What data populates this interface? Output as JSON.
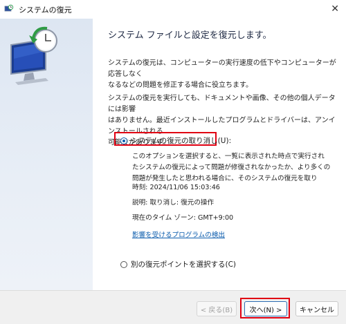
{
  "window": {
    "title": "システムの復元",
    "close_label": "✕"
  },
  "content": {
    "heading": "システム ファイルと設定を復元します。",
    "para1_line1": "システムの復元は、コンピューターの実行速度の低下やコンピューターが応答しなく",
    "para1_line2": "なるなどの問題を修正する場合に役立ちます。",
    "para2_line1": "システムの復元を実行しても、ドキュメントや画像、その他の個人データには影響",
    "para2_line2": "はありません。最近インストールしたプログラムとドライバーは、アンインストールされる",
    "para2_line3": "可能性があります。"
  },
  "option_undo": {
    "label": "システムの復元の取り消し(U):",
    "checked": true,
    "desc_line1": "このオプションを選択すると、一覧に表示された時点で実行され",
    "desc_line2": "たシステムの復元によって問題が修復されなかったか、より多くの",
    "desc_line3": "問題が発生したと思われる場合に、そのシステムの復元を取り",
    "time": "時刻: 2024/11/06 15:03:46",
    "description": "説明: 取り消し: 復元の操作",
    "timezone": "現在のタイム ゾーン: GMT+9:00",
    "link": "影響を受けるプログラムの検出"
  },
  "option_other": {
    "label": "別の復元ポイントを選択する(C)",
    "checked": false
  },
  "footer": {
    "back_label": "< 戻る(B)",
    "next_label": "次へ(N) >",
    "cancel_label": "キャンセル"
  },
  "colors": {
    "accent": "#0b5cad",
    "highlight": "#e00012",
    "heading": "#1f2a44"
  },
  "icons": {
    "title": "system-restore-icon",
    "hero": "system-restore-monitor-icon"
  }
}
